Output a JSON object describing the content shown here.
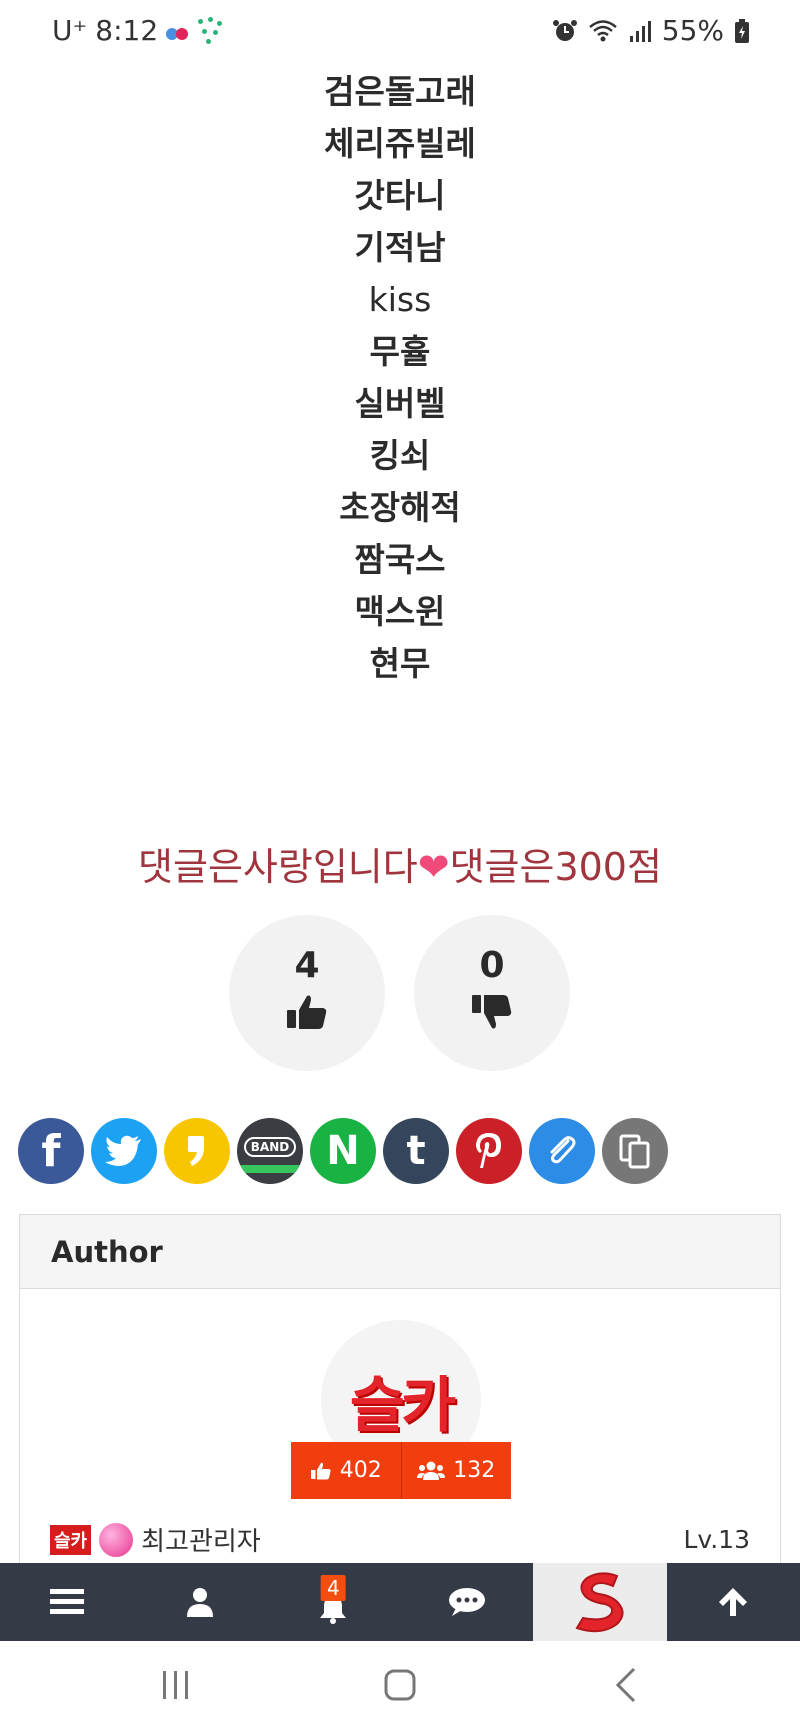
{
  "status_bar": {
    "carrier": "U⁺",
    "time": "8:12",
    "battery": "55%"
  },
  "names": [
    {
      "text": "검은돌고래",
      "bold": true
    },
    {
      "text": "체리쥬빌레",
      "bold": true
    },
    {
      "text": "갓타니",
      "bold": true
    },
    {
      "text": "기적남",
      "bold": true
    },
    {
      "text": "kiss",
      "bold": false
    },
    {
      "text": "무휼",
      "bold": true
    },
    {
      "text": "실버벨",
      "bold": true
    },
    {
      "text": "킹쇠",
      "bold": true
    },
    {
      "text": "초장해적",
      "bold": true
    },
    {
      "text": "짬국스",
      "bold": true
    },
    {
      "text": "맥스윈",
      "bold": true
    },
    {
      "text": "현무",
      "bold": true
    }
  ],
  "comment": {
    "before": "댓글은사랑입니다",
    "after": "댓글은300점"
  },
  "votes": {
    "up": "4",
    "down": "0"
  },
  "share": [
    {
      "name": "facebook",
      "glyph": "f",
      "color": "#3b5998"
    },
    {
      "name": "twitter",
      "glyph": "🐦",
      "color": "#1da1f2"
    },
    {
      "name": "kakaostory",
      "glyph": "❟",
      "color": "#f7c600"
    },
    {
      "name": "band",
      "glyph": "BAND",
      "color": "#3a3d42"
    },
    {
      "name": "naver",
      "glyph": "N",
      "color": "#19b343"
    },
    {
      "name": "tumblr",
      "glyph": "t",
      "color": "#35465c"
    },
    {
      "name": "pinterest",
      "glyph": "P",
      "color": "#cb2027"
    },
    {
      "name": "copy-link",
      "glyph": "🔗",
      "color": "#2d8ce5"
    },
    {
      "name": "copy-text",
      "glyph": "⧉",
      "color": "#777777"
    }
  ],
  "author": {
    "header": "Author",
    "avatar_text": "슬카",
    "likes": "402",
    "followers": "132",
    "badge": "슬카",
    "role": "최고관리자",
    "level": "Lv.13"
  },
  "app_nav": {
    "notification_count": "4"
  }
}
